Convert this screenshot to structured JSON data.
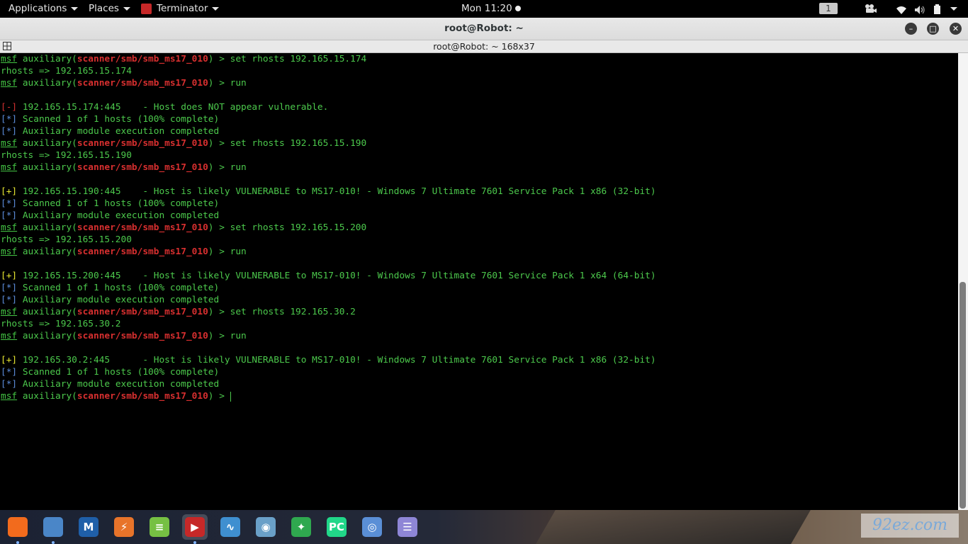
{
  "topbar": {
    "applications": "Applications",
    "places": "Places",
    "app_name": "Terminator",
    "clock": "Mon 11:20",
    "workspace": "1",
    "tray_icons": [
      "camera-icon",
      "wifi-icon",
      "volume-icon",
      "battery-icon",
      "caret-icon"
    ]
  },
  "window": {
    "title": "root@Robot: ~",
    "tab_title": "root@Robot: ~ 168x37"
  },
  "terminal": {
    "prompt_word": "msf",
    "prompt_module": "scanner/smb/smb_ms17_010",
    "lines": [
      {
        "type": "prompt",
        "cmd": "set rhosts 192.165.15.174"
      },
      {
        "type": "plain",
        "text": "rhosts => 192.165.15.174"
      },
      {
        "type": "prompt",
        "cmd": "run"
      },
      {
        "type": "blank"
      },
      {
        "type": "status",
        "tag": "[-]",
        "cls": "neg",
        "text": "192.165.15.174:445    - Host does NOT appear vulnerable."
      },
      {
        "type": "status",
        "tag": "[*]",
        "cls": "info",
        "text": "Scanned 1 of 1 hosts (100% complete)"
      },
      {
        "type": "status",
        "tag": "[*]",
        "cls": "info",
        "text": "Auxiliary module execution completed"
      },
      {
        "type": "prompt",
        "cmd": "set rhosts 192.165.15.190"
      },
      {
        "type": "plain",
        "text": "rhosts => 192.165.15.190"
      },
      {
        "type": "prompt",
        "cmd": "run"
      },
      {
        "type": "blank"
      },
      {
        "type": "status",
        "tag": "[+]",
        "cls": "pos",
        "text": "192.165.15.190:445    - Host is likely VULNERABLE to MS17-010! - Windows 7 Ultimate 7601 Service Pack 1 x86 (32-bit)"
      },
      {
        "type": "status",
        "tag": "[*]",
        "cls": "info",
        "text": "Scanned 1 of 1 hosts (100% complete)"
      },
      {
        "type": "status",
        "tag": "[*]",
        "cls": "info",
        "text": "Auxiliary module execution completed"
      },
      {
        "type": "prompt",
        "cmd": "set rhosts 192.165.15.200"
      },
      {
        "type": "plain",
        "text": "rhosts => 192.165.15.200"
      },
      {
        "type": "prompt",
        "cmd": "run"
      },
      {
        "type": "blank"
      },
      {
        "type": "status",
        "tag": "[+]",
        "cls": "pos",
        "text": "192.165.15.200:445    - Host is likely VULNERABLE to MS17-010! - Windows 7 Ultimate 7601 Service Pack 1 x64 (64-bit)"
      },
      {
        "type": "status",
        "tag": "[*]",
        "cls": "info",
        "text": "Scanned 1 of 1 hosts (100% complete)"
      },
      {
        "type": "status",
        "tag": "[*]",
        "cls": "info",
        "text": "Auxiliary module execution completed"
      },
      {
        "type": "prompt",
        "cmd": "set rhosts 192.165.30.2"
      },
      {
        "type": "plain",
        "text": "rhosts => 192.165.30.2"
      },
      {
        "type": "prompt",
        "cmd": "run"
      },
      {
        "type": "blank"
      },
      {
        "type": "status",
        "tag": "[+]",
        "cls": "pos",
        "text": "192.165.30.2:445      - Host is likely VULNERABLE to MS17-010! - Windows 7 Ultimate 7601 Service Pack 1 x86 (32-bit)"
      },
      {
        "type": "status",
        "tag": "[*]",
        "cls": "info",
        "text": "Scanned 1 of 1 hosts (100% complete)"
      },
      {
        "type": "status",
        "tag": "[*]",
        "cls": "info",
        "text": "Auxiliary module execution completed"
      },
      {
        "type": "prompt",
        "cmd": "",
        "cursor": true
      }
    ]
  },
  "dock": {
    "items": [
      {
        "name": "firefox-icon",
        "glyph": "",
        "color": "#f26b1d",
        "dot": true
      },
      {
        "name": "files-icon",
        "glyph": "",
        "color": "#4a86c8",
        "dot": true
      },
      {
        "name": "metasploit-icon",
        "glyph": "M",
        "color": "#1f5fa8",
        "dot": false
      },
      {
        "name": "burpsuite-icon",
        "glyph": "⚡",
        "color": "#e8742a",
        "dot": false
      },
      {
        "name": "leafpad-icon",
        "glyph": "≡",
        "color": "#76c043",
        "dot": false
      },
      {
        "name": "terminator-icon",
        "glyph": "▶",
        "color": "#c62828",
        "dot": true,
        "active": true
      },
      {
        "name": "wireshark-icon",
        "glyph": "∿",
        "color": "#3f8fd0",
        "dot": false
      },
      {
        "name": "eye-icon",
        "glyph": "◉",
        "color": "#6aa0c8",
        "dot": false
      },
      {
        "name": "faraday-icon",
        "glyph": "✦",
        "color": "#2fa84f",
        "dot": false
      },
      {
        "name": "pycharm-icon",
        "glyph": "PC",
        "color": "#21d789",
        "dot": false
      },
      {
        "name": "chromium-icon",
        "glyph": "◎",
        "color": "#5a8fd6",
        "dot": false
      },
      {
        "name": "text-editor-icon",
        "glyph": "☰",
        "color": "#8e86d6",
        "dot": false
      }
    ],
    "watermark": "92ez.com"
  }
}
